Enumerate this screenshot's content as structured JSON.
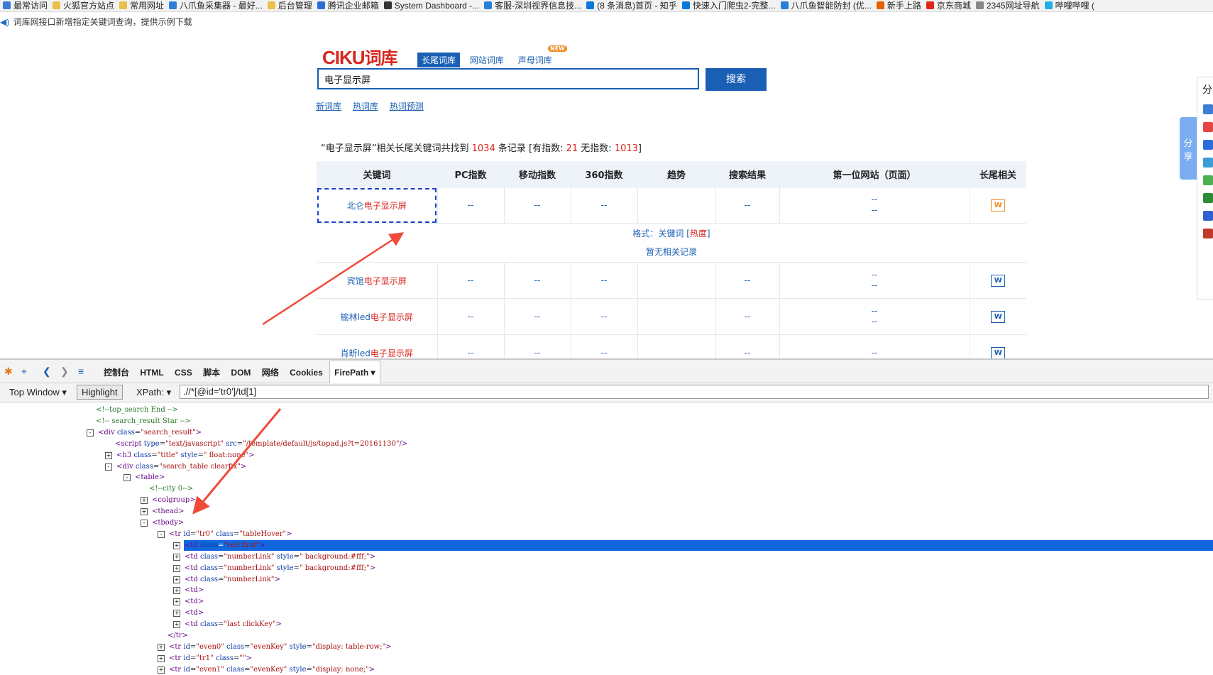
{
  "bookmarks": [
    {
      "label": "最常访问",
      "icon": "star-icon",
      "color": "#3a7bd5"
    },
    {
      "label": "火狐官方站点",
      "icon": "folder-icon",
      "color": "#e8c04a"
    },
    {
      "label": "常用网址",
      "icon": "folder-icon",
      "color": "#e8c04a"
    },
    {
      "label": "八爪鱼采集器 - 最好...",
      "icon": "octopus-icon",
      "color": "#2b7fd8"
    },
    {
      "label": "后台管理",
      "icon": "folder-icon",
      "color": "#e8c04a"
    },
    {
      "label": "腾讯企业邮箱",
      "icon": "mail-icon",
      "color": "#2b6dd8"
    },
    {
      "label": "System Dashboard -...",
      "icon": "x-icon",
      "color": "#333333"
    },
    {
      "label": "客服-深圳视界信息技...",
      "icon": "octopus-icon",
      "color": "#2b7fd8"
    },
    {
      "label": "(8 条消息)首页 - 知乎",
      "icon": "zhihu-icon",
      "color": "#0a78d8"
    },
    {
      "label": "快速入门爬虫2-完整...",
      "icon": "zhihu-icon",
      "color": "#0a78d8"
    },
    {
      "label": "八爪鱼智能防封 (优...",
      "icon": "octopus-icon",
      "color": "#2b7fd8"
    },
    {
      "label": "新手上路",
      "icon": "firefox-icon",
      "color": "#e66000"
    },
    {
      "label": "京东商城",
      "icon": "jd-icon",
      "color": "#e1251b"
    },
    {
      "label": "2345网址导航",
      "icon": "globe-icon",
      "color": "#888888"
    },
    {
      "label": "哔哩哔哩 (",
      "icon": "bilibili-icon",
      "color": "#23ade5"
    }
  ],
  "notice": {
    "text": "词库网接口新增指定关键词查询，提供示例下载"
  },
  "logo": {
    "part1": "CIKU",
    "part2": "词库"
  },
  "tabs": [
    {
      "label": "长尾词库",
      "active": true
    },
    {
      "label": "网站词库",
      "active": false
    },
    {
      "label": "声母词库",
      "active": false
    }
  ],
  "new_badge": "NEW",
  "search": {
    "value": "电子显示屏",
    "button": "搜索"
  },
  "sublinks": [
    "新词库",
    "热词库",
    "热词预测"
  ],
  "summary": {
    "prefix": "“电子显示屏”相关长尾关键词共找到",
    "total": "1034",
    "mid": "条记录 [有指数:",
    "with_index": "21",
    "mid2": "无指数:",
    "without_index": "1013",
    "suffix": "]"
  },
  "table": {
    "headers": [
      "关键词",
      "PC指数",
      "移动指数",
      "360指数",
      "趋势",
      "搜索结果",
      "第一位网站（页面）",
      "长尾相关"
    ],
    "rows": [
      {
        "prefix": "北仑",
        "keyword": "电子显示屏",
        "pc": "--",
        "mobile": "--",
        "i360": "--",
        "trend": "",
        "results": "--",
        "site1": "--",
        "site2": "--"
      },
      {
        "prefix": "宾馆",
        "keyword": "电子显示屏",
        "pc": "--",
        "mobile": "--",
        "i360": "--",
        "trend": "",
        "results": "--",
        "site1": "--",
        "site2": "--"
      },
      {
        "prefix": "榆林led",
        "keyword": "电子显示屏",
        "pc": "--",
        "mobile": "--",
        "i360": "--",
        "trend": "",
        "results": "--",
        "site1": "--",
        "site2": "--"
      },
      {
        "prefix": "肖昕led",
        "keyword": "电子显示屏",
        "pc": "--",
        "mobile": "--",
        "i360": "--",
        "trend": "",
        "results": "--",
        "site1": "--",
        "site2": ""
      }
    ],
    "format_label": "格式：关键词 [",
    "format_heat": "热度",
    "format_end": "]",
    "no_records": "暂无相关记录",
    "word_icon": "W"
  },
  "side": {
    "share": "分享",
    "panel_head": "分"
  },
  "devtools": {
    "tabs": [
      "控制台",
      "HTML",
      "CSS",
      "脚本",
      "DOM",
      "网络",
      "Cookies",
      "FirePath ▾"
    ],
    "top_window": "Top Window ▾",
    "highlight": "Highlight",
    "xpath_label": "XPath: ▾",
    "xpath_value": ".//*[@id='tr0']/td[1]",
    "tree": [
      "<!--top_search End -->",
      "<!-- search_result Star -->",
      "<div class=\"search_result\">",
      "<script type=\"text/javascript\" src=\"/template/default/js/topad.js?t=20161130\"/>",
      "<h3 class=\"title\" style=\" float:none\">",
      "<div class=\"search_table clearfix\">",
      "<table>",
      "<!--city 0-->",
      "<colgroup>",
      "<thead>",
      "<tbody>",
      "<tr id=\"tr0\" class=\"tableHover\">",
      "<td class=\"red first\">",
      "<td class=\"numberLink\" style=\" background:#fff;\">",
      "<td class=\"numberLink\" style=\" background:#fff;\">",
      "<td class=\"numberLink\">",
      "<td>",
      "<td>",
      "<td>",
      "<td class=\"last clickKey\">",
      "</tr>",
      "<tr id=\"even0\" class=\"evenKey\" style=\"display: table-row;\">",
      "<tr id=\"tr1\" class=\"\">",
      "<tr id=\"even1\" class=\"evenKey\" style=\"display: none;\">"
    ]
  }
}
